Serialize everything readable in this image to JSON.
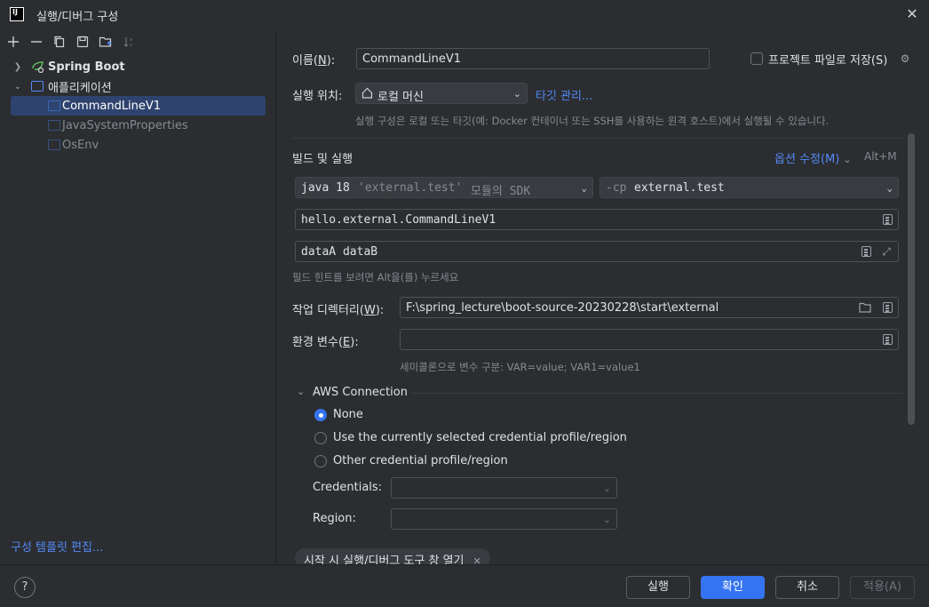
{
  "window": {
    "title": "실행/디버그 구성",
    "logo_text": "IJ"
  },
  "left": {
    "tree": [
      {
        "label": "Spring Boot",
        "expanded": false
      },
      {
        "label": "애플리케이션",
        "expanded": true
      },
      {
        "label": "CommandLineV1",
        "selected": true
      },
      {
        "label": "JavaSystemProperties"
      },
      {
        "label": "OsEnv"
      }
    ],
    "edit_templates": "구성 템플릿 편집..."
  },
  "form": {
    "name_label": "이름(N):",
    "name_label_parts": [
      "이름(",
      "N",
      "):"
    ],
    "name_value": "CommandLineV1",
    "store_as_project_file": "프로젝트 파일로 저장(S)",
    "run_on_label": "실행 위치:",
    "run_on_value": "로컬 머신",
    "manage_targets": "타깃 관리...",
    "run_on_hint": "실행 구성은 로컬 또는 타깃(예: Docker 컨테이너 또는 SSH를 사용하는 원격 호스트)에서 실행될 수 있습니다.",
    "build_run_title": "빌드 및 실행",
    "modify_options": "옵션 수정(M)",
    "modify_shortcut": "Alt+M",
    "jdk_main": "java 18",
    "jdk_module": "'external.test'",
    "jdk_suffix": "모듈의 SDK",
    "cp_flag": "-cp",
    "cp_value": "external.test",
    "main_class": "hello.external.CommandLineV1",
    "program_args": "dataA dataB",
    "field_hint": "필드 힌트를 보려면 Alt을(를) 누르세요",
    "working_dir_label_parts": [
      "작업 디렉터리(",
      "W",
      "):"
    ],
    "working_dir": "F:\\spring_lecture\\boot-source-20230228\\start\\external",
    "env_vars_label_parts": [
      "환경 변수(",
      "E",
      "):"
    ],
    "env_vars_value": "",
    "env_hint": "세미콜론으로 변수 구분: VAR=value; VAR1=value1",
    "aws_title": "AWS Connection",
    "aws_options": [
      {
        "label": "None",
        "selected": true
      },
      {
        "label": "Use the currently selected credential profile/region",
        "selected": false
      },
      {
        "label": "Other credential profile/region",
        "selected": false
      }
    ],
    "credentials_label": "Credentials:",
    "region_label": "Region:",
    "chip_label": "시작 시 실행/디버그 도구 창 열기"
  },
  "buttons": {
    "help": "?",
    "run": "실행",
    "ok": "확인",
    "cancel": "취소",
    "apply": "적용(A)"
  },
  "colors": {
    "accent": "#3574f0",
    "link": "#548af7",
    "background": "#2b2d30",
    "selection": "#2e436e"
  }
}
